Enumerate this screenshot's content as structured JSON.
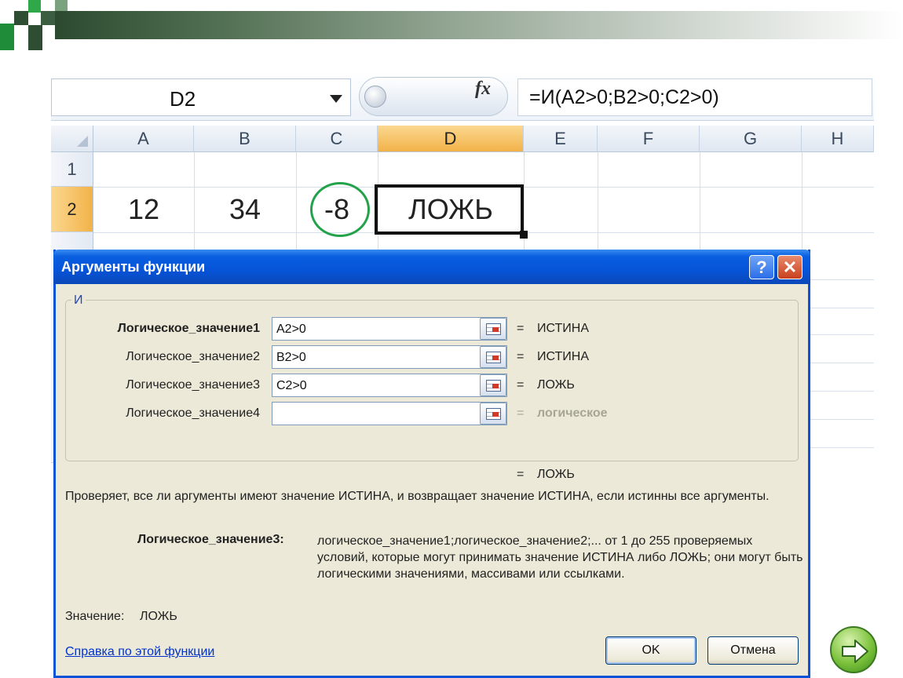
{
  "excel": {
    "name_box": "D2",
    "fx_symbol": "fx",
    "formula": "=И(A2>0;B2>0;C2>0)",
    "columns": [
      "A",
      "B",
      "C",
      "D",
      "E",
      "F",
      "G",
      "H"
    ],
    "active_column": "D",
    "rows": [
      "1",
      "2"
    ],
    "active_row": "2",
    "cells": {
      "A2": "12",
      "B2": "34",
      "C2": "-8",
      "D2": "ЛОЖЬ"
    },
    "highlight_color": "#24a24b"
  },
  "dialog": {
    "title": "Аргументы функции",
    "help_button": "?",
    "close_button": "✕",
    "function_name": "И",
    "args": [
      {
        "label": "Логическое_значение1",
        "value": "A2>0",
        "result": "ИСТИНА"
      },
      {
        "label": "Логическое_значение2",
        "value": "B2>0",
        "result": "ИСТИНА"
      },
      {
        "label": "Логическое_значение3",
        "value": "C2>0",
        "result": "ЛОЖЬ"
      },
      {
        "label": "Логическое_значение4",
        "value": "",
        "result": "логическое"
      }
    ],
    "equals": "=",
    "total_result": "ЛОЖЬ",
    "description": "Проверяет, все ли аргументы имеют значение ИСТИНА, и возвращает значение ИСТИНА, если истинны все аргументы.",
    "arg_help_name": "Логическое_значение3:",
    "arg_help_text": "логическое_значение1;логическое_значение2;... от 1 до 255 проверяемых условий, которые могут принимать значение ИСТИНА либо ЛОЖЬ; они могут быть логическими значениями, массивами или ссылками.",
    "value_label": "Значение:",
    "value_result": "ЛОЖЬ",
    "help_link": "Справка по этой функции",
    "ok": "OK",
    "cancel": "Отмена",
    "title_bar_color": "#0654d8"
  },
  "slide": {
    "next_icon": "next-arrow-icon"
  }
}
